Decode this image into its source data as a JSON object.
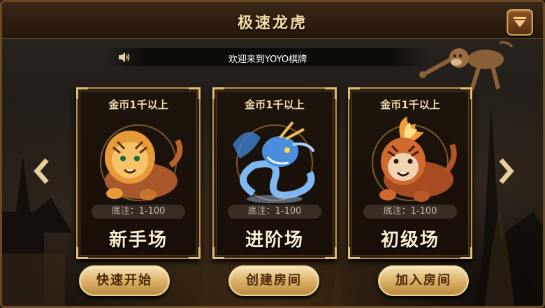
{
  "header": {
    "title": "极速龙虎",
    "menu_icon": "dropdown-triangle-icon"
  },
  "marquee": {
    "icon": "speaker-icon",
    "text": "欢迎来到YOYO棋牌"
  },
  "navigation": {
    "prev_icon": "chevron-left-icon",
    "next_icon": "chevron-right-icon"
  },
  "rooms": [
    {
      "threshold": "金币1千以上",
      "bet": "底注：1-100",
      "name": "新手场",
      "art": "golden-tiger"
    },
    {
      "threshold": "金币1千以上",
      "bet": "底注：1-100",
      "name": "进阶场",
      "art": "blue-dragon"
    },
    {
      "threshold": "金币1千以上",
      "bet": "底注：1-100",
      "name": "初级场",
      "art": "flaming-tiger"
    }
  ],
  "actions": {
    "quick_start": "快速开始",
    "create_room": "创建房间",
    "join_room": "加入房间"
  },
  "colors": {
    "title": "#f6dca1",
    "card_border": "#b8904f",
    "button_gold": "#d9ad62",
    "button_text": "#4a2608"
  }
}
